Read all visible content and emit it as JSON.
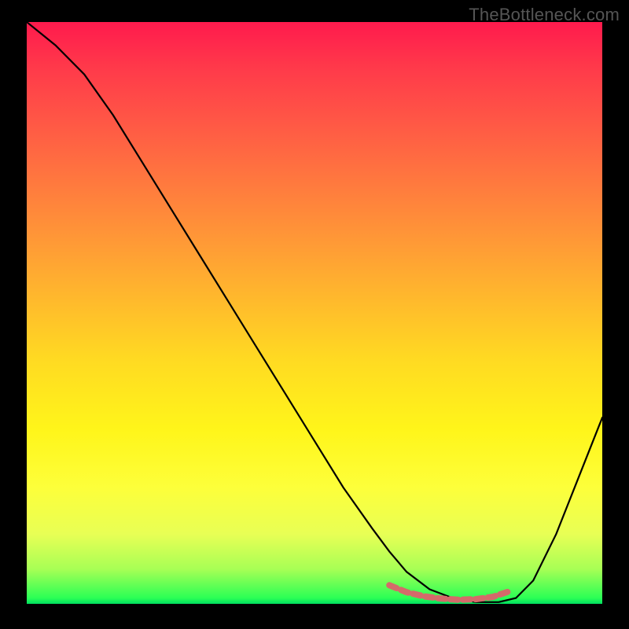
{
  "watermark": "TheBottleneck.com",
  "chart_data": {
    "type": "line",
    "title": "",
    "xlabel": "",
    "ylabel": "",
    "xlim": [
      0,
      100
    ],
    "ylim": [
      0,
      100
    ],
    "series": [
      {
        "name": "bottleneck-curve",
        "color": "#000000",
        "x": [
          0,
          5,
          10,
          15,
          20,
          25,
          30,
          35,
          40,
          45,
          50,
          55,
          60,
          63,
          66,
          70,
          74,
          78,
          82,
          85,
          88,
          92,
          96,
          100
        ],
        "y": [
          100,
          96,
          91,
          84,
          76,
          68,
          60,
          52,
          44,
          36,
          28,
          20,
          13,
          9,
          5.5,
          2.5,
          1,
          0.3,
          0.3,
          1,
          4,
          12,
          22,
          32
        ]
      },
      {
        "name": "optimal-zone",
        "color": "#d46a6a",
        "x": [
          63,
          66,
          69,
          72,
          75,
          78,
          81,
          84
        ],
        "y": [
          3.2,
          2.0,
          1.3,
          0.9,
          0.7,
          0.8,
          1.2,
          2.2
        ]
      }
    ],
    "gradient": {
      "top": "#ff1a4d",
      "mid": "#ffd820",
      "bottom": "#00e060"
    }
  }
}
